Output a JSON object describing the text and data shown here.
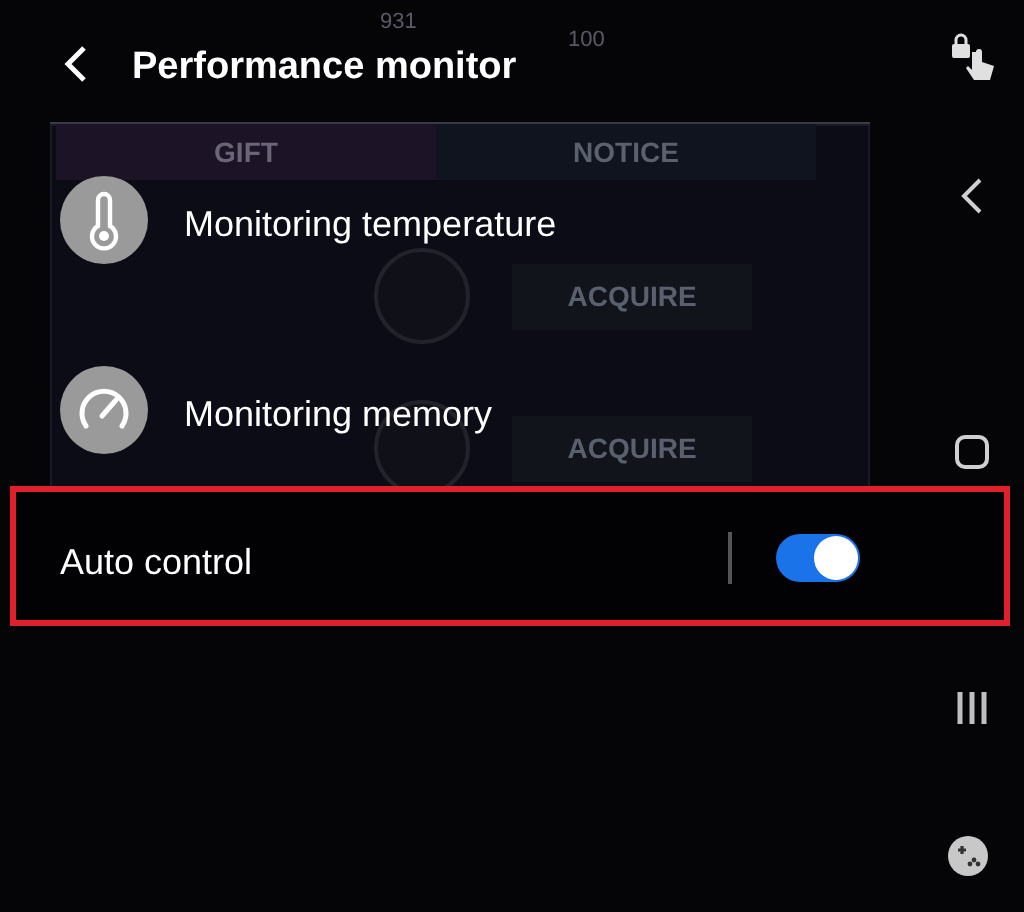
{
  "game_background": {
    "counters": [
      "931",
      "100"
    ],
    "tabs": [
      {
        "label": "GIFT",
        "selected": true
      },
      {
        "label": "NOTICE",
        "selected": false
      }
    ],
    "buttons": [
      "ACQUIRE",
      "ACQUIRE"
    ]
  },
  "panel": {
    "title": "Performance monitor",
    "items": [
      {
        "kind": "temperature",
        "label": "Monitoring temperature"
      },
      {
        "kind": "memory",
        "label": "Monitoring memory"
      }
    ],
    "auto_control": {
      "label": "Auto control",
      "on": true,
      "highlighted": true
    }
  }
}
